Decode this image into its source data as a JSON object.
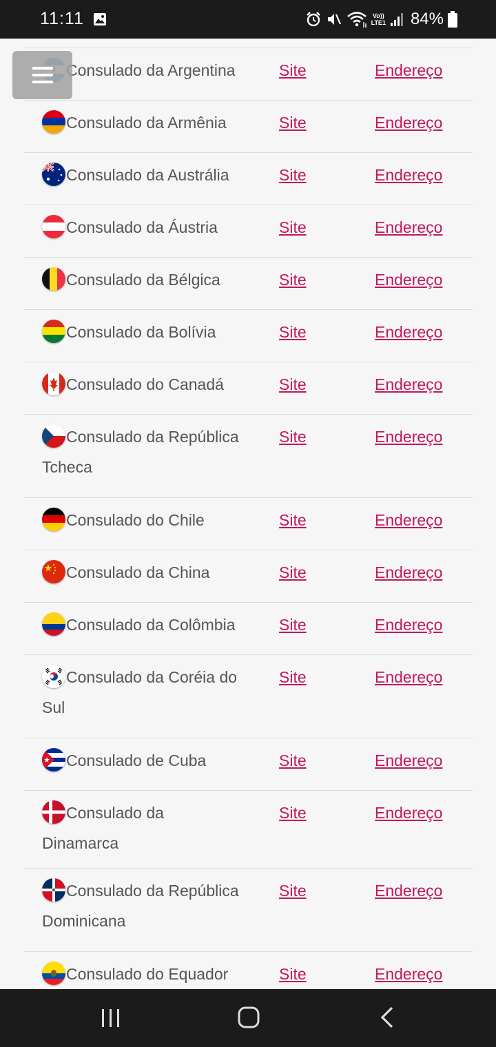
{
  "status_bar": {
    "time": "11:11",
    "battery": "84%",
    "volte_label_top": "Vo))",
    "volte_label_bottom": "LTE1"
  },
  "menu": {
    "icon": "hamburger-menu-icon"
  },
  "links": {
    "site": "Site",
    "address": "Endereço"
  },
  "consulates": [
    {
      "name": "Consulado da Argentina",
      "flag": "argentina"
    },
    {
      "name": "Consulado da Armênia",
      "flag": "armenia"
    },
    {
      "name": "Consulado da Austrália",
      "flag": "australia"
    },
    {
      "name": "Consulado da Áustria",
      "flag": "austria"
    },
    {
      "name": "Consulado da Bélgica",
      "flag": "belgium"
    },
    {
      "name": "Consulado da Bolívia",
      "flag": "bolivia"
    },
    {
      "name": "Consulado do Canadá",
      "flag": "canada"
    },
    {
      "name": "Consulado da República Tcheca",
      "flag": "czech"
    },
    {
      "name": "Consulado do Chile",
      "flag": "germany"
    },
    {
      "name": "Consulado da China",
      "flag": "china"
    },
    {
      "name": "Consulado da Colômbia",
      "flag": "colombia"
    },
    {
      "name": "Consulado da Coréia do Sul",
      "flag": "south-korea"
    },
    {
      "name": "Consulado de Cuba",
      "flag": "cuba"
    },
    {
      "name": "Consulado da Dinamarca",
      "flag": "denmark"
    },
    {
      "name": "Consulado da República Dominicana",
      "flag": "dominican-republic"
    },
    {
      "name": "Consulado do Equador",
      "flag": "ecuador"
    }
  ],
  "colors": {
    "link": "#c2185b",
    "text": "#555555",
    "divider": "#dcdcdc",
    "bars": "#1b1b1b"
  }
}
